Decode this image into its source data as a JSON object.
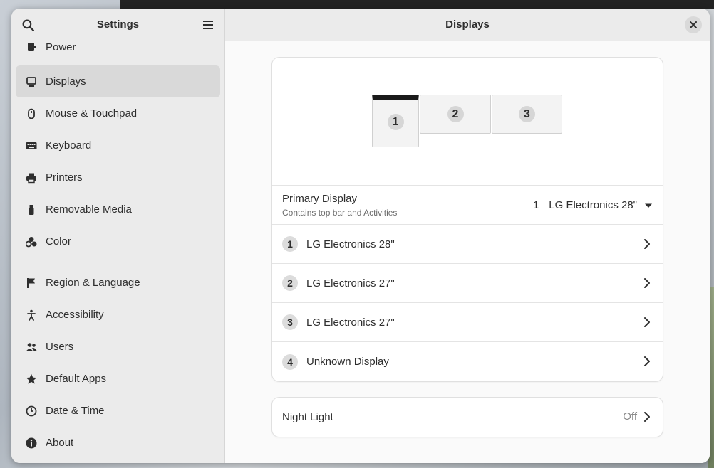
{
  "sidebar": {
    "title": "Settings",
    "items": [
      {
        "label": "Power",
        "icon": "power-icon"
      },
      {
        "label": "Displays",
        "icon": "display-icon",
        "active": true
      },
      {
        "label": "Mouse & Touchpad",
        "icon": "mouse-icon"
      },
      {
        "label": "Keyboard",
        "icon": "keyboard-icon"
      },
      {
        "label": "Printers",
        "icon": "printer-icon"
      },
      {
        "label": "Removable Media",
        "icon": "usb-icon"
      },
      {
        "label": "Color",
        "icon": "color-icon"
      },
      {
        "label": "Region & Language",
        "icon": "flag-icon"
      },
      {
        "label": "Accessibility",
        "icon": "accessibility-icon"
      },
      {
        "label": "Users",
        "icon": "users-icon"
      },
      {
        "label": "Default Apps",
        "icon": "star-icon"
      },
      {
        "label": "Date & Time",
        "icon": "clock-icon"
      },
      {
        "label": "About",
        "icon": "info-icon"
      }
    ]
  },
  "main": {
    "title": "Displays",
    "arrangement": {
      "monitors": [
        "1",
        "2",
        "3"
      ]
    },
    "primary_display": {
      "label": "Primary Display",
      "subtitle": "Contains top bar and Activities",
      "value_number": "1",
      "value_name": "LG Electronics 28\""
    },
    "displays": [
      {
        "number": "1",
        "name": "LG Electronics 28\""
      },
      {
        "number": "2",
        "name": "LG Electronics 27\""
      },
      {
        "number": "3",
        "name": "LG Electronics 27\""
      },
      {
        "number": "4",
        "name": "Unknown Display"
      }
    ],
    "night_light": {
      "label": "Night Light",
      "value": "Off"
    }
  },
  "colors": {
    "sidebar_bg": "#ebebeb",
    "active_item": "#d9d9d9",
    "card_bg": "#ffffff"
  }
}
